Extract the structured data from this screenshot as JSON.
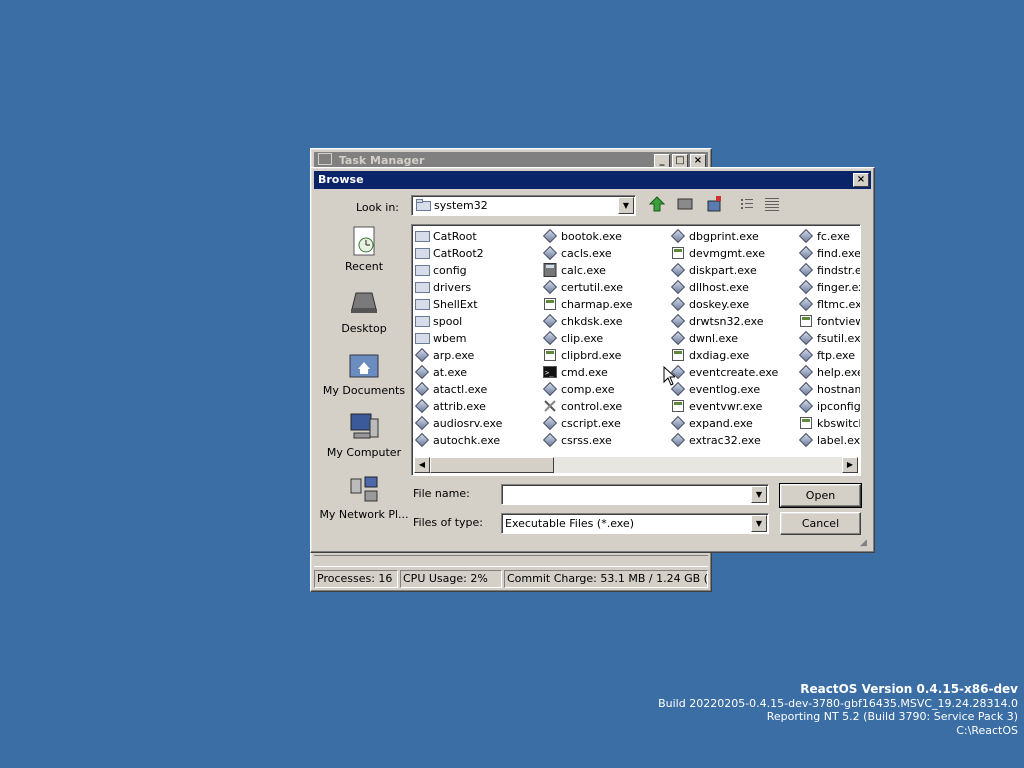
{
  "taskmanager": {
    "title": "Task Manager",
    "status": {
      "processes": "Processes: 16",
      "cpu": "CPU Usage:    2%",
      "commit": "Commit Charge: 53.1 MB / 1.24 GB (4%)"
    }
  },
  "browse": {
    "title": "Browse",
    "lookin_label": "Look in:",
    "lookin_value": "system32",
    "places": [
      "Recent",
      "Desktop",
      "My Documents",
      "My Computer",
      "My Network Pl..."
    ],
    "columns": [
      [
        {
          "name": "CatRoot",
          "icon": "folder"
        },
        {
          "name": "CatRoot2",
          "icon": "folder"
        },
        {
          "name": "config",
          "icon": "folder"
        },
        {
          "name": "drivers",
          "icon": "folder"
        },
        {
          "name": "ShellExt",
          "icon": "folder"
        },
        {
          "name": "spool",
          "icon": "folder"
        },
        {
          "name": "wbem",
          "icon": "folder"
        },
        {
          "name": "arp.exe",
          "icon": "exe"
        },
        {
          "name": "at.exe",
          "icon": "exe"
        },
        {
          "name": "atactl.exe",
          "icon": "exe"
        },
        {
          "name": "attrib.exe",
          "icon": "exe"
        },
        {
          "name": "audiosrv.exe",
          "icon": "exe"
        },
        {
          "name": "autochk.exe",
          "icon": "exe"
        }
      ],
      [
        {
          "name": "bootok.exe",
          "icon": "exe"
        },
        {
          "name": "cacls.exe",
          "icon": "exe"
        },
        {
          "name": "calc.exe",
          "icon": "calc"
        },
        {
          "name": "certutil.exe",
          "icon": "exe"
        },
        {
          "name": "charmap.exe",
          "icon": "app"
        },
        {
          "name": "chkdsk.exe",
          "icon": "exe"
        },
        {
          "name": "clip.exe",
          "icon": "exe"
        },
        {
          "name": "clipbrd.exe",
          "icon": "app"
        },
        {
          "name": "cmd.exe",
          "icon": "cmd"
        },
        {
          "name": "comp.exe",
          "icon": "exe"
        },
        {
          "name": "control.exe",
          "icon": "tools"
        },
        {
          "name": "cscript.exe",
          "icon": "exe"
        },
        {
          "name": "csrss.exe",
          "icon": "exe"
        }
      ],
      [
        {
          "name": "dbgprint.exe",
          "icon": "exe"
        },
        {
          "name": "devmgmt.exe",
          "icon": "app"
        },
        {
          "name": "diskpart.exe",
          "icon": "exe"
        },
        {
          "name": "dllhost.exe",
          "icon": "exe"
        },
        {
          "name": "doskey.exe",
          "icon": "exe"
        },
        {
          "name": "drwtsn32.exe",
          "icon": "exe"
        },
        {
          "name": "dwnl.exe",
          "icon": "exe"
        },
        {
          "name": "dxdiag.exe",
          "icon": "app"
        },
        {
          "name": "eventcreate.exe",
          "icon": "exe"
        },
        {
          "name": "eventlog.exe",
          "icon": "exe"
        },
        {
          "name": "eventvwr.exe",
          "icon": "app"
        },
        {
          "name": "expand.exe",
          "icon": "exe"
        },
        {
          "name": "extrac32.exe",
          "icon": "exe"
        }
      ],
      [
        {
          "name": "fc.exe",
          "icon": "exe"
        },
        {
          "name": "find.exe",
          "icon": "exe"
        },
        {
          "name": "findstr.ex",
          "icon": "exe"
        },
        {
          "name": "finger.exe",
          "icon": "exe"
        },
        {
          "name": "fltmc.exe",
          "icon": "exe"
        },
        {
          "name": "fontview.",
          "icon": "app"
        },
        {
          "name": "fsutil.exe",
          "icon": "exe"
        },
        {
          "name": "ftp.exe",
          "icon": "exe"
        },
        {
          "name": "help.exe",
          "icon": "exe"
        },
        {
          "name": "hostname",
          "icon": "exe"
        },
        {
          "name": "ipconfig.e",
          "icon": "exe"
        },
        {
          "name": "kbswitch.",
          "icon": "app"
        },
        {
          "name": "label.exe",
          "icon": "exe"
        }
      ]
    ],
    "filename_label": "File name:",
    "filename_value": "",
    "filetype_label": "Files of type:",
    "filetype_value": "Executable Files (*.exe)",
    "open_label": "Open",
    "cancel_label": "Cancel"
  },
  "version": {
    "line1": "ReactOS Version 0.4.15-x86-dev",
    "line2": "Build 20220205-0.4.15-dev-3780-gbf16435.MSVC_19.24.28314.0",
    "line3": "Reporting NT 5.2 (Build 3790: Service Pack 3)",
    "line4": "C:\\ReactOS"
  }
}
